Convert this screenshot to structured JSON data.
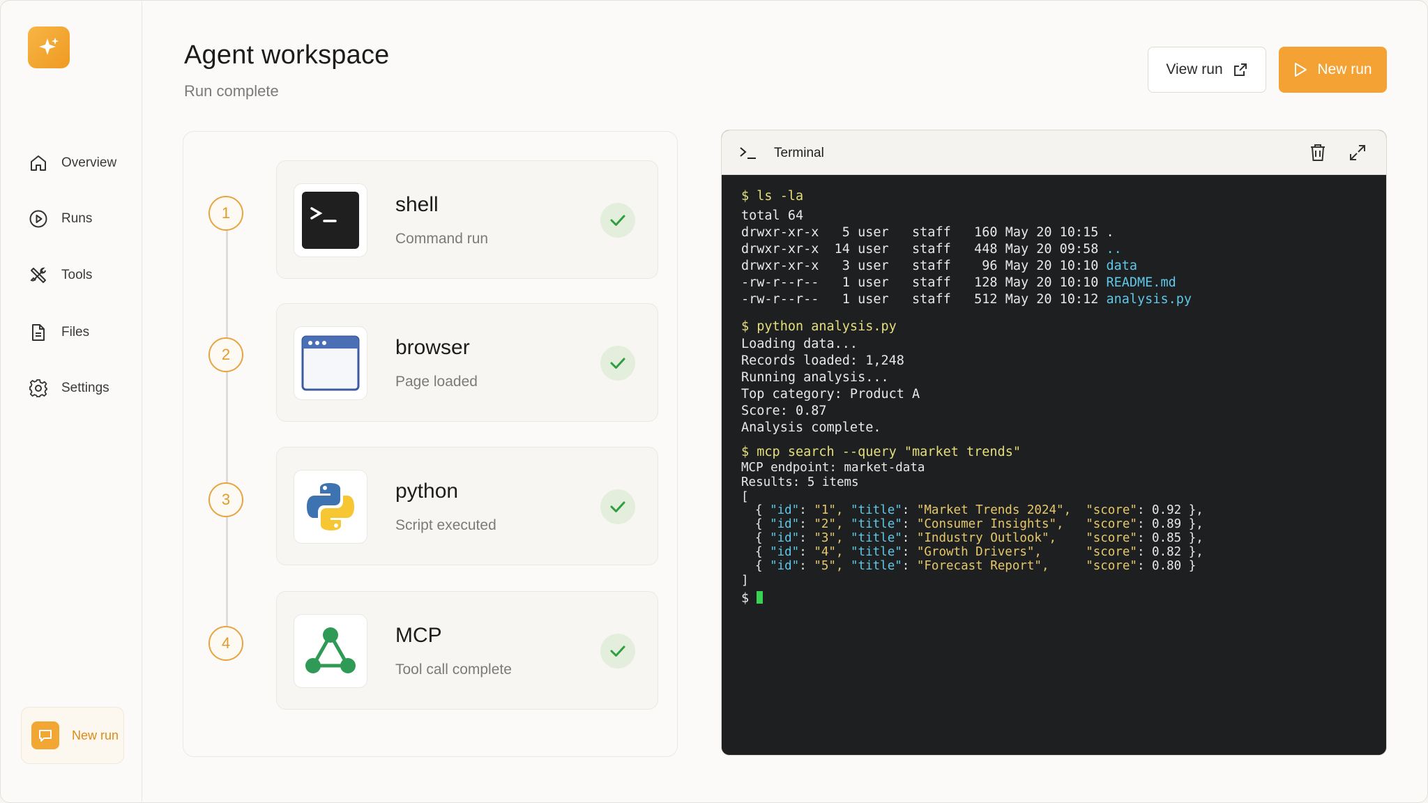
{
  "header": {
    "title": "Agent workspace",
    "subtitle": "Run complete",
    "view_run": "View run",
    "new_run": "New run"
  },
  "sidebar": {
    "items": [
      {
        "label": "Overview",
        "icon": "home-icon"
      },
      {
        "label": "Runs",
        "icon": "play-circle-icon"
      },
      {
        "label": "Tools",
        "icon": "tools-icon"
      },
      {
        "label": "Files",
        "icon": "file-icon"
      },
      {
        "label": "Settings",
        "icon": "gear-icon"
      }
    ],
    "new_run": "New run"
  },
  "steps": [
    {
      "num": "1",
      "name": "shell",
      "status": "Command run",
      "icon": "terminal-icon"
    },
    {
      "num": "2",
      "name": "browser",
      "status": "Page loaded",
      "icon": "browser-window-icon"
    },
    {
      "num": "3",
      "name": "python",
      "status": "Script executed",
      "icon": "python-icon"
    },
    {
      "num": "4",
      "name": "MCP",
      "status": "Tool call complete",
      "icon": "mcp-network-icon"
    }
  ],
  "terminal": {
    "title": "Terminal",
    "cmd1": "$ ls -la",
    "ls_total": "total 64",
    "ls": [
      {
        "prefix": "drwxr-xr-x   5 user   staff   160 May 20 10:15 ",
        "name": "."
      },
      {
        "prefix": "drwxr-xr-x  14 user   staff   448 May 20 09:58 ",
        "name": ".."
      },
      {
        "prefix": "drwxr-xr-x   3 user   staff    96 May 20 10:10 ",
        "name": "data"
      },
      {
        "prefix": "-rw-r--r--   1 user   staff   128 May 20 10:10 ",
        "name": "README.md"
      },
      {
        "prefix": "-rw-r--r--   1 user   staff   512 May 20 10:12 ",
        "name": "analysis.py"
      }
    ],
    "cmd2": "$ python analysis.py",
    "py_out": [
      "Loading data...",
      "Records loaded: 1,248",
      "Running analysis...",
      "Top category: Product A",
      "Score: 0.87",
      "Analysis complete."
    ],
    "cmd3": "$ mcp search --query \"market trends\"",
    "mcp_out": [
      "MCP endpoint: market-data",
      "Results: 5 items",
      "["
    ],
    "results": [
      {
        "id": "\"1\",",
        "title": "\"Market Trends 2024\",",
        "pad": "  ",
        "score": "0.92 },"
      },
      {
        "id": "\"2\",",
        "title": "\"Consumer Insights\",",
        "pad": "   ",
        "score": "0.89 },"
      },
      {
        "id": "\"3\",",
        "title": "\"Industry Outlook\",",
        "pad": "    ",
        "score": "0.85 },"
      },
      {
        "id": "\"4\",",
        "title": "\"Growth Drivers\",",
        "pad": "      ",
        "score": "0.82 },"
      },
      {
        "id": "\"5\",",
        "title": "\"Forecast Report\",",
        "pad": "     ",
        "score": "0.80 }"
      }
    ],
    "close_bracket": "]",
    "prompt": "$"
  },
  "colors": {
    "accent": "#f3a233",
    "check_green": "#2e9e3f",
    "terminal_bg": "#1d1f20"
  }
}
